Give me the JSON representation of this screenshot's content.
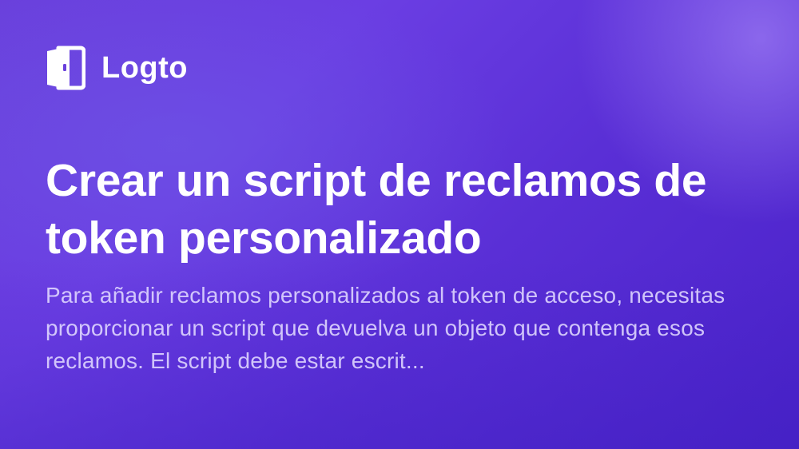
{
  "brand": {
    "name": "Logto",
    "icon": "door-icon"
  },
  "article": {
    "title": "Crear un script de reclamos de token personalizado",
    "description": "Para añadir reclamos personalizados al token de acceso, necesitas proporcionar un script que devuelva un objeto que contenga esos reclamos. El script debe estar escrit..."
  },
  "colors": {
    "background_start": "#6a40dc",
    "background_end": "#4a22c9",
    "text": "#ffffff"
  }
}
